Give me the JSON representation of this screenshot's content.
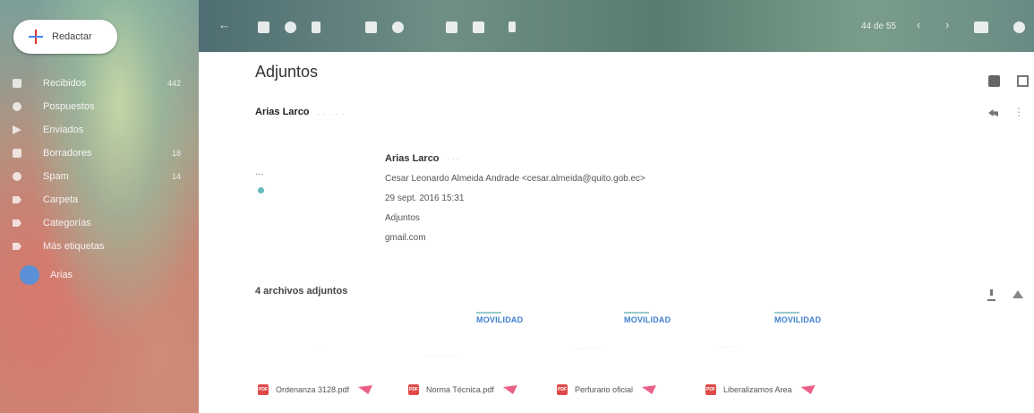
{
  "compose": {
    "label": "Redactar"
  },
  "sidebar": {
    "items": [
      {
        "label": "Recibidos",
        "count": "442",
        "icon": "inbox-icon"
      },
      {
        "label": "Pospuestos",
        "count": "",
        "icon": "clock-icon"
      },
      {
        "label": "Enviados",
        "count": "",
        "icon": "send-icon"
      },
      {
        "label": "Borradores",
        "count": "18",
        "icon": "draft-icon"
      },
      {
        "label": "Spam",
        "count": "14",
        "icon": "spam-icon"
      },
      {
        "label": "Carpeta",
        "count": "",
        "icon": "tag-icon"
      },
      {
        "label": "Categorías",
        "count": "",
        "icon": "tag-icon"
      },
      {
        "label": "Más etiquetas",
        "count": "",
        "icon": "tag-icon"
      }
    ],
    "account": {
      "label": "Arias"
    }
  },
  "toolbar": {
    "pager": "44 de 55"
  },
  "email": {
    "subject": "Adjuntos",
    "top_sender": "Arias Larco",
    "top_sender_meta": ".  .  .  .  .",
    "forwarded": {
      "name": "Arias Larco",
      "name_meta": "· · ·",
      "to": "Cesar Leonardo Almeida Andrade <cesar.almeida@quito.gob.ec>",
      "date": "29 sept. 2016 15:31",
      "subject": "Adjuntos",
      "extra": "gmail.com"
    },
    "dots": "...",
    "attachments_count": "4 archivos adjuntos",
    "thumb_brand": "MOVILIDAD",
    "files": [
      {
        "name": "Ordenanza 3128.pdf",
        "type": "PDF"
      },
      {
        "name": "Norma Técnica.pdf",
        "type": "PDF"
      },
      {
        "name": "Perfurario oficial",
        "type": "PDF"
      },
      {
        "name": "Liberalizamos Area",
        "type": "PDF"
      }
    ]
  }
}
